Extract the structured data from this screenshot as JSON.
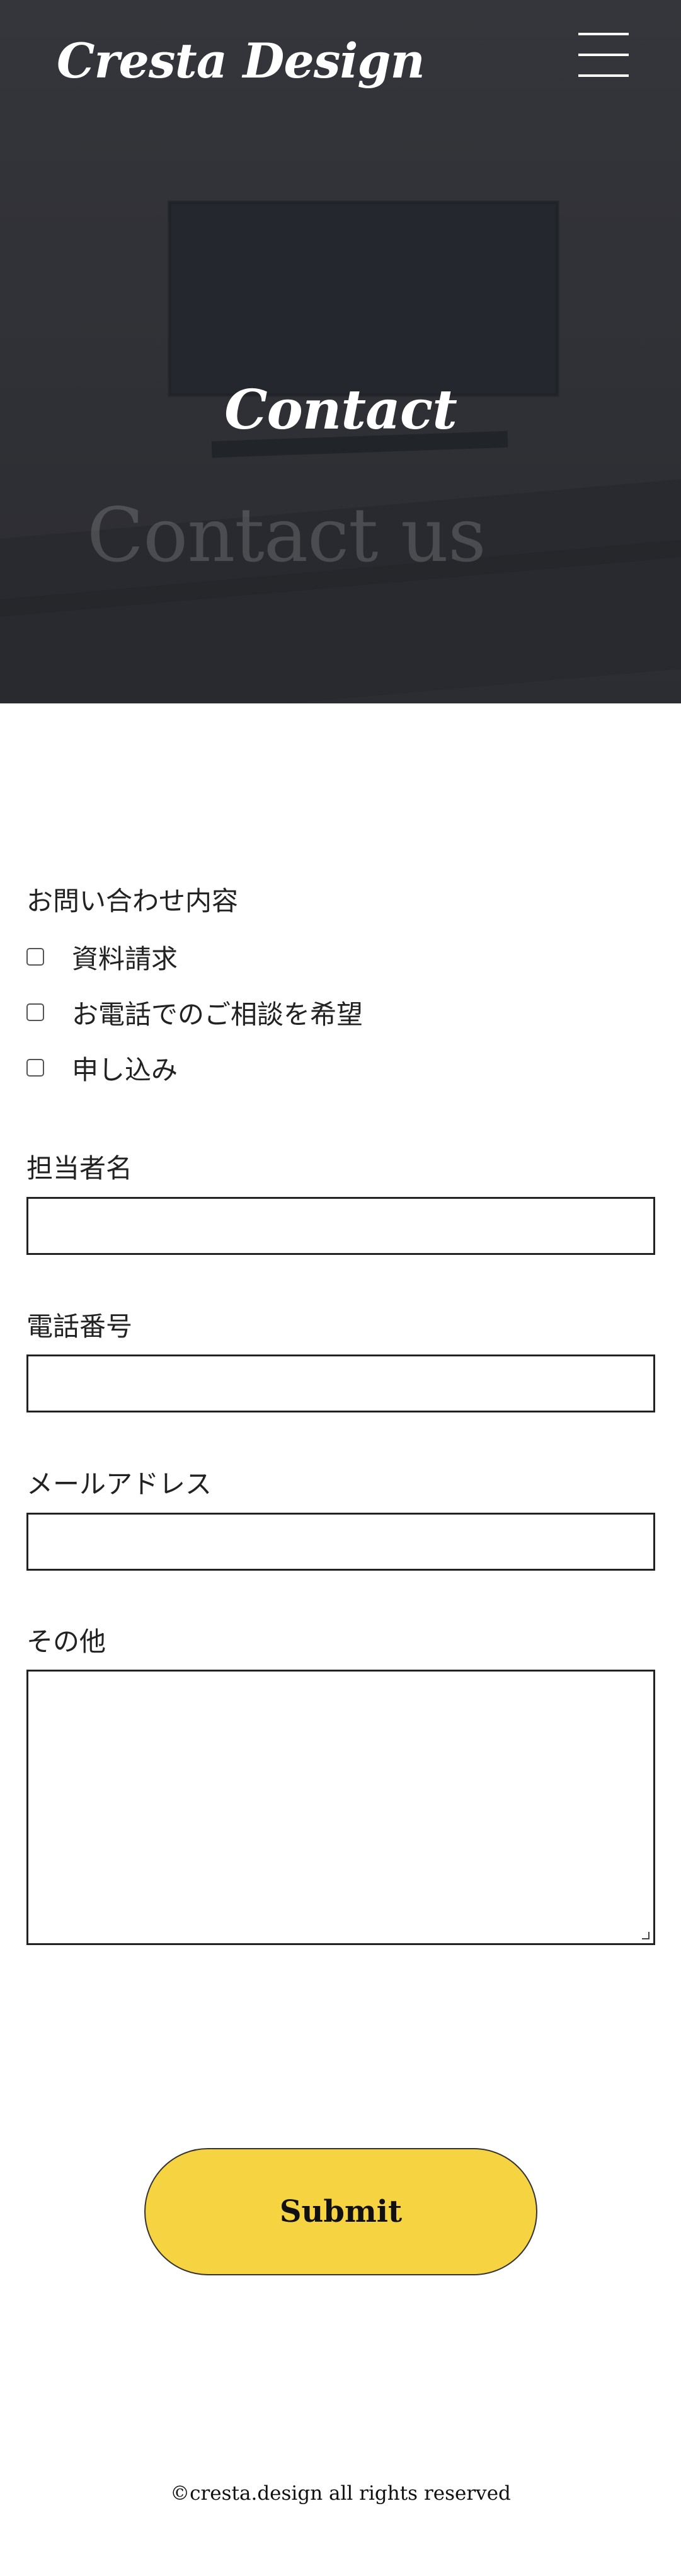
{
  "header": {
    "logo": "Cresta Design",
    "menu_icon": "hamburger-menu-icon"
  },
  "hero": {
    "title": "Contact",
    "subtitle": "Contact us"
  },
  "form": {
    "inquiry": {
      "label": "お問い合わせ内容",
      "options": [
        {
          "label": "資料請求",
          "checked": false
        },
        {
          "label": "お電話でのご相談を希望",
          "checked": false
        },
        {
          "label": "申し込み",
          "checked": false
        }
      ]
    },
    "contact_person": {
      "label": "担当者名",
      "value": ""
    },
    "phone": {
      "label": "電話番号",
      "value": ""
    },
    "email": {
      "label": "メールアドレス",
      "value": ""
    },
    "other": {
      "label": "その他",
      "value": ""
    },
    "submit_label": "Submit"
  },
  "footer": {
    "copyright": "©cresta.design all rights reserved"
  },
  "colors": {
    "accent": "#f6d340",
    "hero_background": "#34363b",
    "text": "#222222"
  }
}
